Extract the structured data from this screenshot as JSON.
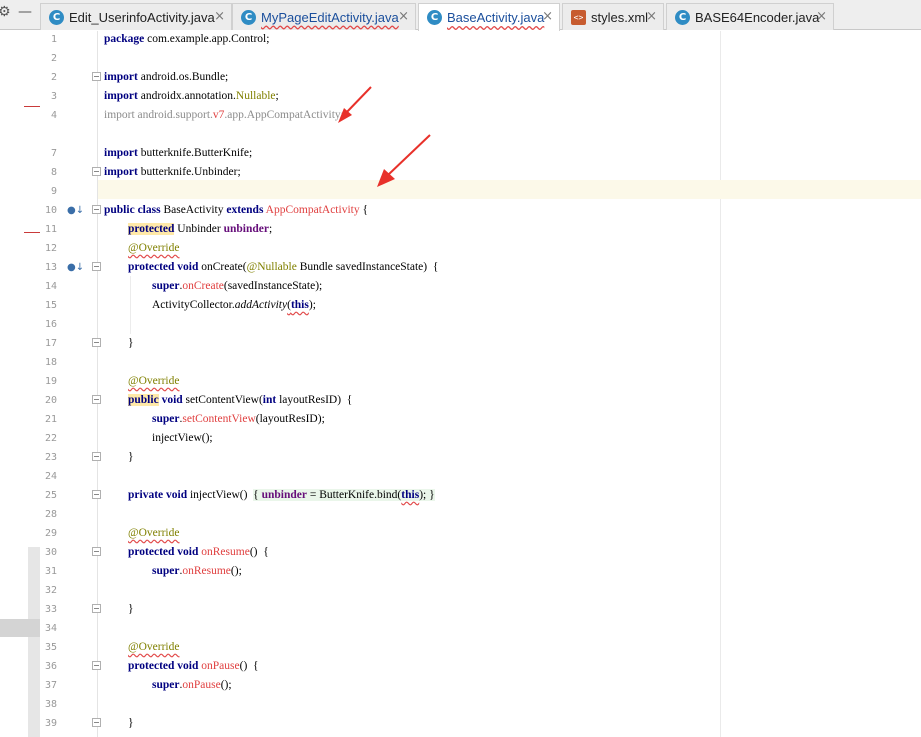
{
  "tabbar": {
    "tabs": [
      {
        "label": "Edit_UserinfoActivity.java",
        "icon": "C",
        "modified": false
      },
      {
        "label": "MyPageEditActivity.java",
        "icon": "C",
        "modified": true
      },
      {
        "label": "BaseActivity.java",
        "icon": "C",
        "modified": true,
        "active": true
      },
      {
        "label": "styles.xml",
        "icon": "xml-file-icon",
        "modified": false
      },
      {
        "label": "BASE64Encoder.java",
        "icon": "C",
        "modified": false
      }
    ],
    "close_glyph": "×"
  },
  "gutter": {
    "line_numbers": [
      "1",
      "2",
      "3",
      "4",
      "5",
      "7",
      "8",
      "9",
      "10",
      "11",
      "12",
      "13",
      "14",
      "15",
      "16",
      "17",
      "18",
      "19",
      "20",
      "21",
      "22",
      "23",
      "24",
      "25",
      "28",
      "29",
      "30",
      "31",
      "32",
      "33",
      "34",
      "35",
      "36",
      "37",
      "38",
      "39"
    ]
  },
  "code": {
    "l1": [
      "package",
      " com.example.app.Control;"
    ],
    "l3": [
      "import",
      " android.os.Bundle;"
    ],
    "l4": [
      "import",
      " androidx.annotation.",
      "Nullable",
      ";"
    ],
    "l5": [
      "import android.support.",
      "v7",
      ".app.AppCompatActivity;"
    ],
    "l7": [
      "import",
      " butterknife.ButterKnife;"
    ],
    "l8": [
      "import",
      " butterknife.Unbinder;"
    ],
    "l10": [
      "public",
      " ",
      "class",
      " BaseActivity ",
      "extends",
      " ",
      "AppCompatActivity",
      " {"
    ],
    "l11": [
      "protected",
      " Unbinder ",
      "unbinder",
      ";"
    ],
    "l12": [
      "@Override"
    ],
    "l13": [
      "protected",
      " ",
      "void",
      " onCreate(",
      "@Nullable",
      " Bundle savedInstanceState)  {"
    ],
    "l14": [
      "super",
      ".",
      "onCreate",
      "(savedInstanceState);"
    ],
    "l15": [
      "ActivityCollector.",
      "addActivity",
      "(",
      "this",
      ");"
    ],
    "l17": [
      "}"
    ],
    "l19": [
      "@Override"
    ],
    "l20": [
      "public",
      " ",
      "void",
      " setContentView(",
      "int",
      " layoutResID)  {"
    ],
    "l21": [
      "super",
      ".",
      "setContentView",
      "(layoutResID);"
    ],
    "l22": [
      "injectView();"
    ],
    "l23": [
      "}"
    ],
    "l25": [
      "private",
      " ",
      "void",
      " injectView()  ",
      "{ ",
      "unbinder",
      " = ButterKnife.bind(",
      "this",
      "); }"
    ],
    "l29": [
      "@Override"
    ],
    "l30": [
      "protected",
      " ",
      "void",
      " ",
      "onResume",
      "()  {"
    ],
    "l31": [
      "super",
      ".",
      "onResume",
      "();"
    ],
    "l33": [
      "}"
    ],
    "l35": [
      "@Override"
    ],
    "l36": [
      "protected",
      " ",
      "void",
      " ",
      "onPause",
      "()  {"
    ],
    "l37": [
      "super",
      ".",
      "onPause",
      "();"
    ],
    "l39": [
      "}"
    ]
  },
  "colors": {
    "keyword": "#000080",
    "annotation": "#808000",
    "error_red": "#e04040",
    "field_purple": "#660e7a",
    "unused_gray": "#8c8c8c",
    "arrow_red": "#e8312a",
    "tab_badge_blue": "#2f8cc4"
  }
}
